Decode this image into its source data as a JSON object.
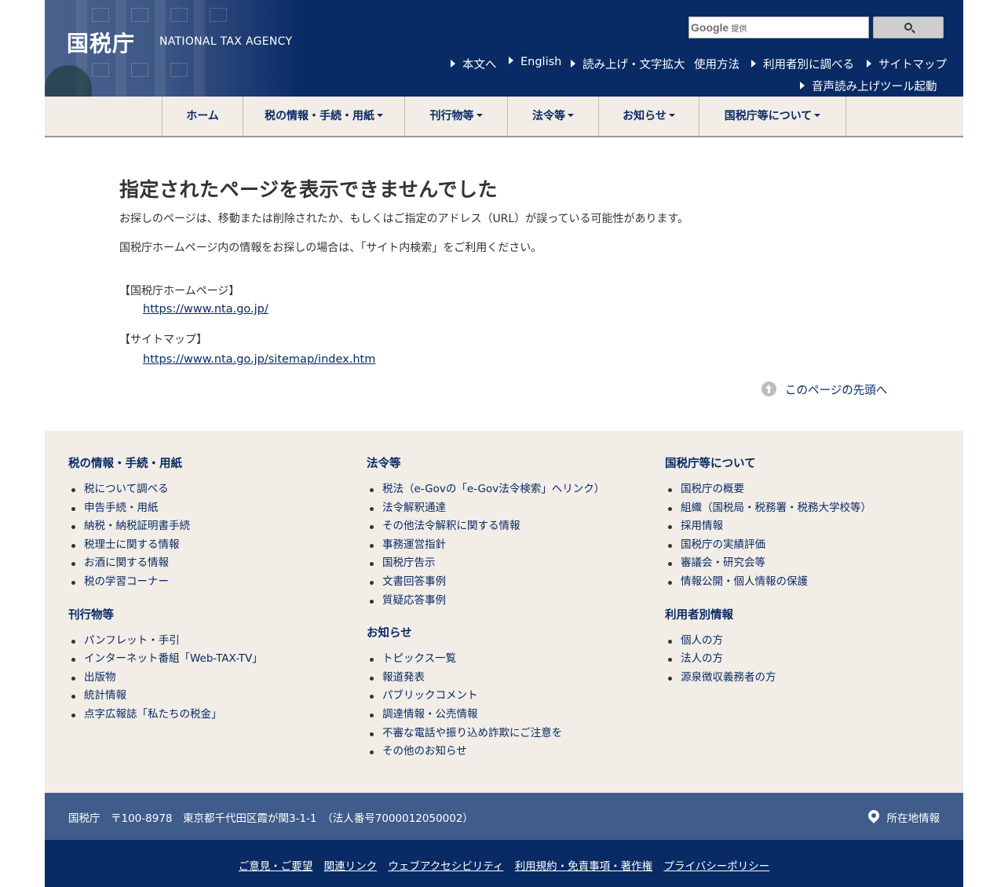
{
  "header": {
    "logo": "国税庁",
    "logo_en": "NATIONAL TAX AGENCY",
    "search": {
      "google_label": "Google",
      "provided_label": "提供",
      "button_icon": "search-icon"
    },
    "utility_links": [
      {
        "label": "本文へ"
      },
      {
        "label": "English"
      },
      {
        "label": "読み上げ・文字拡大"
      },
      {
        "label": "使用方法"
      },
      {
        "label": "利用者別に調べる"
      },
      {
        "label": "サイトマップ"
      },
      {
        "label": "音声読み上げツール起動"
      }
    ]
  },
  "nav": {
    "items": [
      {
        "label": "ホーム"
      },
      {
        "label": "税の情報・手続・用紙"
      },
      {
        "label": "刊行物等"
      },
      {
        "label": "法令等"
      },
      {
        "label": "お知らせ"
      },
      {
        "label": "国税庁等について"
      }
    ]
  },
  "content": {
    "title": "指定されたページを表示できませんでした",
    "para1": "お探しのページは、移動または削除されたか、もしくはご指定のアドレス（URL）が誤っている可能性があります。",
    "para2": "国税庁ホームページ内の情報をお探しの場合は、「サイト内検索」をご利用ください。",
    "home_label": "【国税庁ホームページ】",
    "home_url": "https://www.nta.go.jp/",
    "sitemap_label": "【サイトマップ】",
    "sitemap_url": "https://www.nta.go.jp/sitemap/index.htm",
    "to_top": "このページの先頭へ"
  },
  "footer_map": {
    "col1": [
      {
        "heading": "税の情報・手続・用紙",
        "items": [
          "税について調べる",
          "申告手続・用紙",
          "納税・納税証明書手続",
          "税理士に関する情報",
          "お酒に関する情報",
          "税の学習コーナー"
        ]
      },
      {
        "heading": "刊行物等",
        "items": [
          "パンフレット・手引",
          "インターネット番組「Web-TAX-TV」",
          "出版物",
          "統計情報",
          "点字広報誌「私たちの税金」"
        ]
      }
    ],
    "col2": [
      {
        "heading": "法令等",
        "items": [
          "税法（e-Govの「e-Gov法令検索」へリンク）",
          "法令解釈通達",
          "その他法令解釈に関する情報",
          "事務運営指針",
          "国税庁告示",
          "文書回答事例",
          "質疑応答事例"
        ]
      },
      {
        "heading": "お知らせ",
        "items": [
          "トピックス一覧",
          "報道発表",
          "パブリックコメント",
          "調達情報・公売情報",
          "不審な電話や振り込め詐欺にご注意を",
          "その他のお知らせ"
        ]
      }
    ],
    "col3": [
      {
        "heading": "国税庁等について",
        "items": [
          "国税庁の概要",
          "組織（国税局・税務署・税務大学校等）",
          "採用情報",
          "国税庁の実績評価",
          "審議会・研究会等",
          "情報公開・個人情報の保護"
        ]
      },
      {
        "heading": "利用者別情報",
        "items": [
          "個人の方",
          "法人の方",
          "源泉徴収義務者の方"
        ]
      }
    ]
  },
  "address": {
    "text": "国税庁　〒100-8978　東京都千代田区霞が関3-1-1　（法人番号7000012050002）",
    "location_label": "所在地情報"
  },
  "bottom_links": [
    "ご意見・ご要望",
    "関連リンク",
    "ウェブアクセシビリティ",
    "利用規約・免責事項・著作権",
    "プライバシーポリシー"
  ],
  "colors": {
    "navy": "#082a65",
    "beige": "#f2ede7",
    "address_bar": "#3f5c8a"
  }
}
